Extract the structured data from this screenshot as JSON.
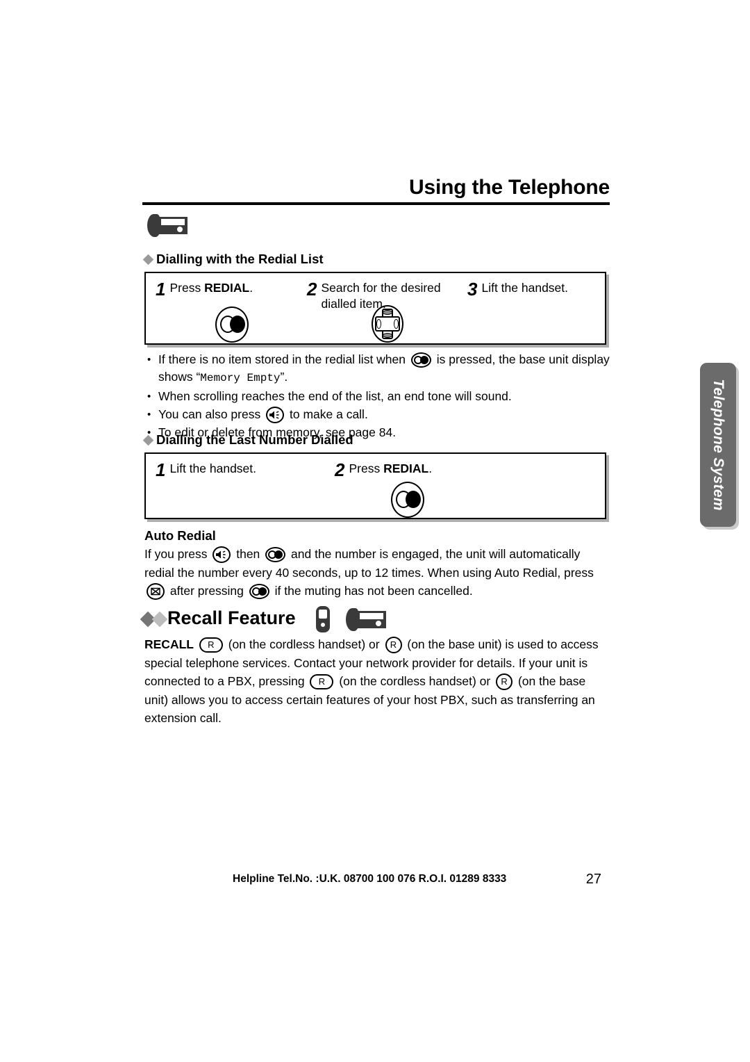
{
  "header": {
    "title": "Using the Telephone",
    "device_icon": "base-unit-icon"
  },
  "section_redial_list": {
    "heading": "Dialling with the Redial List",
    "steps": [
      {
        "num": "1",
        "text_prefix": "Press ",
        "text_bold": "REDIAL",
        "text_suffix": ".",
        "icon": "redial-button-icon"
      },
      {
        "num": "2",
        "text_prefix": "Search for the desired dialled item.",
        "text_bold": "",
        "text_suffix": "",
        "icon": "navigator-key-icon"
      },
      {
        "num": "3",
        "text_prefix": "Lift the handset.",
        "text_bold": "",
        "text_suffix": "",
        "icon": ""
      }
    ]
  },
  "bullets": {
    "b1_part1": "If there is no item stored in the redial list when",
    "b1_part2": "is pressed, the base unit display shows “",
    "b1_mono": "Memory Empty",
    "b1_part3": "”.",
    "b2": "When scrolling reaches the end of the list, an end tone will sound.",
    "b3_part1": "You can also press",
    "b3_part2": "to make a call.",
    "b4": "To edit or delete from memory, see page 84."
  },
  "section_last_number": {
    "heading": "Dialling the Last Number Dialled",
    "steps": [
      {
        "num": "1",
        "text_prefix": "Lift the handset.",
        "text_bold": "",
        "text_suffix": "",
        "icon": ""
      },
      {
        "num": "2",
        "text_prefix": "Press ",
        "text_bold": "REDIAL",
        "text_suffix": ".",
        "icon": "redial-button-icon"
      }
    ]
  },
  "section_auto_redial": {
    "heading": "Auto Redial",
    "p1": "If you press",
    "p2": "then",
    "p3": "and the number is engaged, the unit will automatically redial the number every 40 seconds, up to 12 times. When using Auto Redial, press",
    "p4": "after pressing",
    "p5": "if the muting has not been cancelled."
  },
  "section_recall": {
    "heading": "Recall Feature",
    "p1_bold": "RECALL",
    "p1_r_label": "R",
    "p2": "(on the cordless handset) or",
    "p3": "(on the base unit) is used to access special telephone services. Contact your network provider for details. If your unit is connected to a PBX, pressing",
    "p4": "(on the cordless handset) or",
    "p5": "(on the base unit) allows you to access certain features of your host PBX, such as transferring an extension call."
  },
  "side_tab": {
    "label": "Telephone System",
    "color": "#6b6b6b"
  },
  "footer": {
    "helpline": "Helpline Tel.No. :U.K. 08700 100 076  R.O.I. 01289 8333",
    "page_number": "27"
  }
}
